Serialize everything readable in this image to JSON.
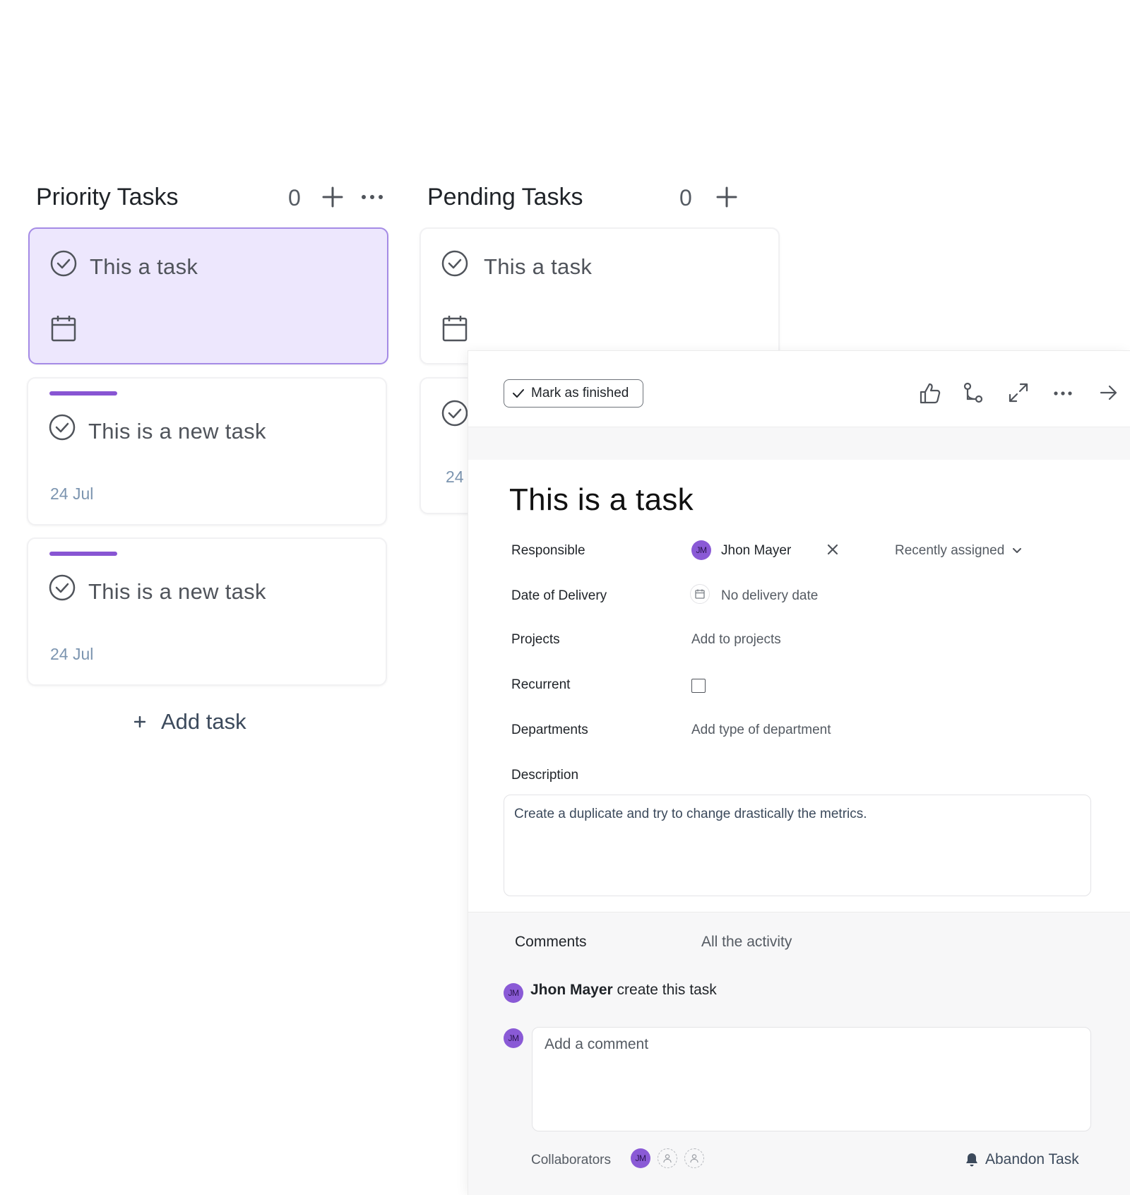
{
  "columns": [
    {
      "title": "Priority Tasks",
      "count": "0",
      "cards": [
        {
          "title": "This a task",
          "date": "",
          "selected": true
        },
        {
          "title": "This is a new task",
          "date": "24 Jul"
        },
        {
          "title": "This is a new task",
          "date": "24 Jul"
        }
      ],
      "add_label": "Add task"
    },
    {
      "title": "Pending Tasks",
      "count": "0",
      "cards": [
        {
          "title": "This a task",
          "date": ""
        },
        {
          "title": "",
          "date": "24"
        }
      ]
    }
  ],
  "detail": {
    "mark_finished_label": "Mark as finished",
    "toolbar_icons": [
      "thumbs-up-icon",
      "subtask-icon",
      "expand-icon",
      "more-icon",
      "close-panel-arrow-icon"
    ],
    "title": "This is a task",
    "fields": {
      "responsible_label": "Responsible",
      "responsible_initials": "JM",
      "responsible_name": "Jhon Mayer",
      "recently_assigned": "Recently assigned",
      "delivery_label": "Date of Delivery",
      "delivery_value": "No delivery date",
      "projects_label": "Projects",
      "projects_value": "Add to projects",
      "recurrent_label": "Recurrent",
      "departments_label": "Departments",
      "departments_value": "Add type of department",
      "description_label": "Description",
      "description_value": "Create a duplicate and try to change drastically the metrics."
    },
    "tabs": {
      "comments": "Comments",
      "activity": "All the activity"
    },
    "activity_entry": {
      "initials": "JM",
      "author": "Jhon Mayer",
      "text": "create this task"
    },
    "comment_initials": "JM",
    "comment_placeholder": "Add a comment",
    "collaborators_label": "Collaborators",
    "collaborator_initials": "JM",
    "abandon_label": "Abandon Task"
  },
  "colors": {
    "accent": "#8855d3",
    "selected_card_bg": "#ede7fd",
    "selected_card_border": "#a58be6",
    "date_text": "#7c95b0",
    "avatar": "#8a5ad6"
  }
}
